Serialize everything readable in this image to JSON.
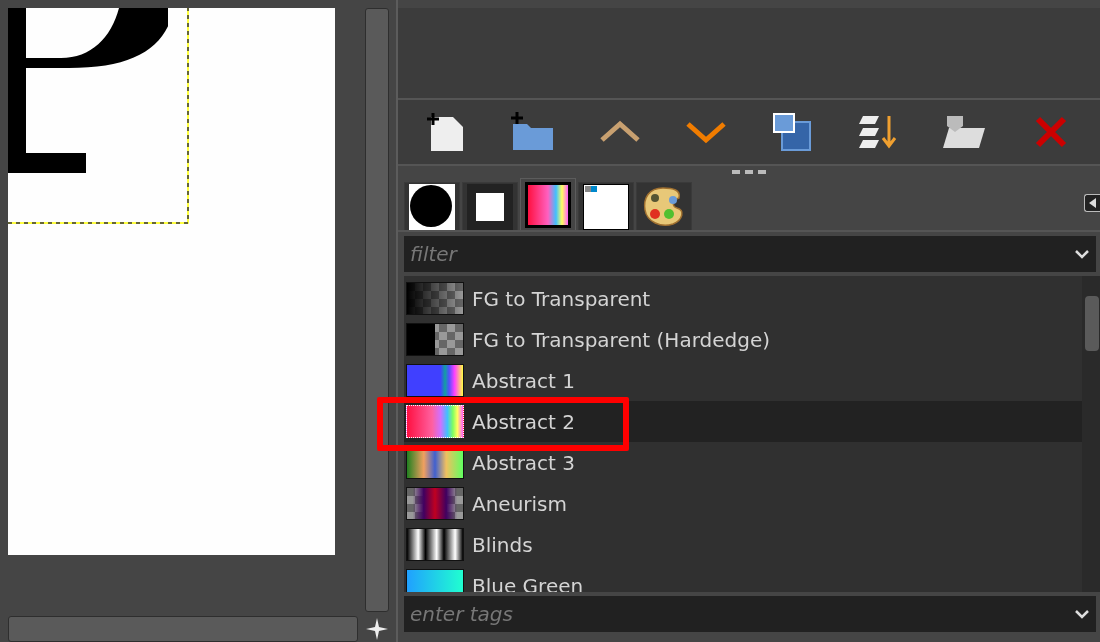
{
  "toolbar": {
    "buttons": [
      {
        "kind": "new"
      },
      {
        "kind": "folder"
      },
      {
        "kind": "up"
      },
      {
        "kind": "down"
      },
      {
        "kind": "duplicate"
      },
      {
        "kind": "sort"
      },
      {
        "kind": "tag"
      },
      {
        "kind": "delete"
      }
    ]
  },
  "tabs": [
    {
      "kind": "brush",
      "selected": false
    },
    {
      "kind": "pattern",
      "selected": false
    },
    {
      "kind": "gradient",
      "selected": true
    },
    {
      "kind": "font",
      "selected": false
    },
    {
      "kind": "palette",
      "selected": false
    }
  ],
  "filter": {
    "placeholder": "filter"
  },
  "gradients": [
    {
      "name": "FG to Transparent",
      "selected": false
    },
    {
      "name": "FG to Transparent (Hardedge)",
      "selected": false
    },
    {
      "name": "Abstract 1",
      "selected": false
    },
    {
      "name": "Abstract 2",
      "selected": true
    },
    {
      "name": "Abstract 3",
      "selected": false
    },
    {
      "name": "Aneurism",
      "selected": false
    },
    {
      "name": "Blinds",
      "selected": false
    },
    {
      "name": "Blue Green",
      "selected": false
    }
  ],
  "tags": {
    "placeholder": "enter tags"
  }
}
